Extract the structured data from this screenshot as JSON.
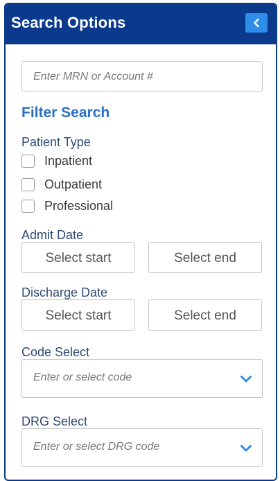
{
  "panel": {
    "title": "Search Options",
    "collapse_icon": "chevron-left-icon"
  },
  "search": {
    "placeholder": "Enter MRN or Account #"
  },
  "filter": {
    "title": "Filter Search",
    "patient_type": {
      "label": "Patient Type",
      "options": [
        "Inpatient",
        "Outpatient",
        "Professional"
      ]
    },
    "admit_date": {
      "label": "Admit Date",
      "start": "Select start",
      "end": "Select end"
    },
    "discharge_date": {
      "label": "Discharge Date",
      "start": "Select start",
      "end": "Select end"
    },
    "code_select": {
      "label": "Code Select",
      "placeholder": "Enter or select code"
    },
    "drg_select": {
      "label": "DRG Select",
      "placeholder": "Enter or select DRG code"
    }
  },
  "colors": {
    "header": "#0b3a8c",
    "accent": "#2e8de8",
    "section_title": "#2a6fc4"
  }
}
